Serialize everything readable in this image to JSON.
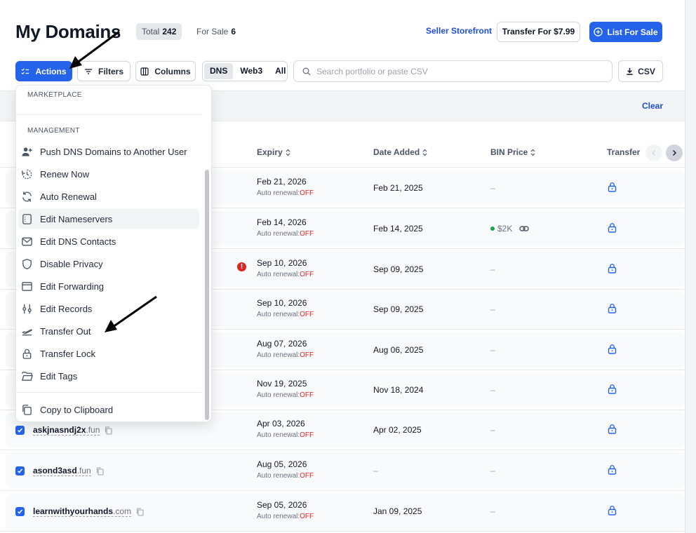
{
  "header": {
    "title": "My Domains",
    "total_label": "Total",
    "total_value": "242",
    "for_sale_label": "For Sale",
    "for_sale_value": "6",
    "seller_storefront": "Seller Storefront",
    "transfer_button": "Transfer For $7.99",
    "list_button": "List For Sale",
    "accent_color": "#2563eb"
  },
  "toolbar": {
    "actions": "Actions",
    "filters": "Filters",
    "columns": "Columns",
    "segments": [
      "DNS",
      "Web3",
      "All"
    ],
    "active_segment": "DNS",
    "search_placeholder": "Search portfolio or paste CSV",
    "csv": "CSV"
  },
  "selection_bar": {
    "clear": "Clear"
  },
  "table": {
    "columns": [
      "Expiry",
      "Date Added",
      "BIN Price",
      "Transfer"
    ],
    "renewal_label": "Auto renewal:",
    "renewal_state": "OFF",
    "rows": [
      {
        "domain": "",
        "tld": "",
        "expiry": "Feb 21, 2026",
        "added": "Feb 21, 2025",
        "bin": "–"
      },
      {
        "domain": "",
        "tld": "",
        "expiry": "Feb 14, 2026",
        "added": "Feb 14, 2025",
        "bin": "$2K"
      },
      {
        "domain": "",
        "tld": "",
        "expiry": "Sep 10, 2026",
        "added": "Sep 09, 2025",
        "bin": "–"
      },
      {
        "domain": "",
        "tld": "",
        "expiry": "Sep 10, 2026",
        "added": "Sep 09, 2025",
        "bin": "–"
      },
      {
        "domain": "",
        "tld": "",
        "expiry": "Aug 07, 2026",
        "added": "Aug 06, 2025",
        "bin": "–"
      },
      {
        "domain": "",
        "tld": "",
        "expiry": "Nov 19, 2025",
        "added": "Nov 18, 2024",
        "bin": "–"
      },
      {
        "domain": "askjnasndj2x",
        "tld": ".fun",
        "expiry": "Apr 03, 2026",
        "added": "Apr 02, 2025",
        "bin": "–"
      },
      {
        "domain": "asond3asd",
        "tld": ".fun",
        "expiry": "Aug 05, 2026",
        "added": "–",
        "bin": "–"
      },
      {
        "domain": "learnwithyourhands",
        "tld": ".com",
        "expiry": "Sep 05, 2026",
        "added": "Jan 09, 2025",
        "bin": "–"
      }
    ]
  },
  "menu": {
    "section_marketplace": "MARKETPLACE",
    "section_management": "MANAGEMENT",
    "items": [
      {
        "label": "Push DNS Domains to Another User",
        "icon": "user-plus-icon"
      },
      {
        "label": "Renew Now",
        "icon": "renew-icon"
      },
      {
        "label": "Auto Renewal",
        "icon": "refresh-icon"
      },
      {
        "label": "Edit Nameservers",
        "icon": "server-icon"
      },
      {
        "label": "Edit DNS Contacts",
        "icon": "mail-icon"
      },
      {
        "label": "Disable Privacy",
        "icon": "shield-icon"
      },
      {
        "label": "Edit Forwarding",
        "icon": "browser-window-icon"
      },
      {
        "label": "Edit Records",
        "icon": "sliders-icon"
      },
      {
        "label": "Transfer Out",
        "icon": "plane-takeoff-icon"
      },
      {
        "label": "Transfer Lock",
        "icon": "lock-icon"
      },
      {
        "label": "Edit Tags",
        "icon": "folder-icon"
      }
    ],
    "footer_item": {
      "label": "Copy to Clipboard",
      "icon": "copy-icon"
    },
    "highlighted": "Edit Nameservers"
  }
}
